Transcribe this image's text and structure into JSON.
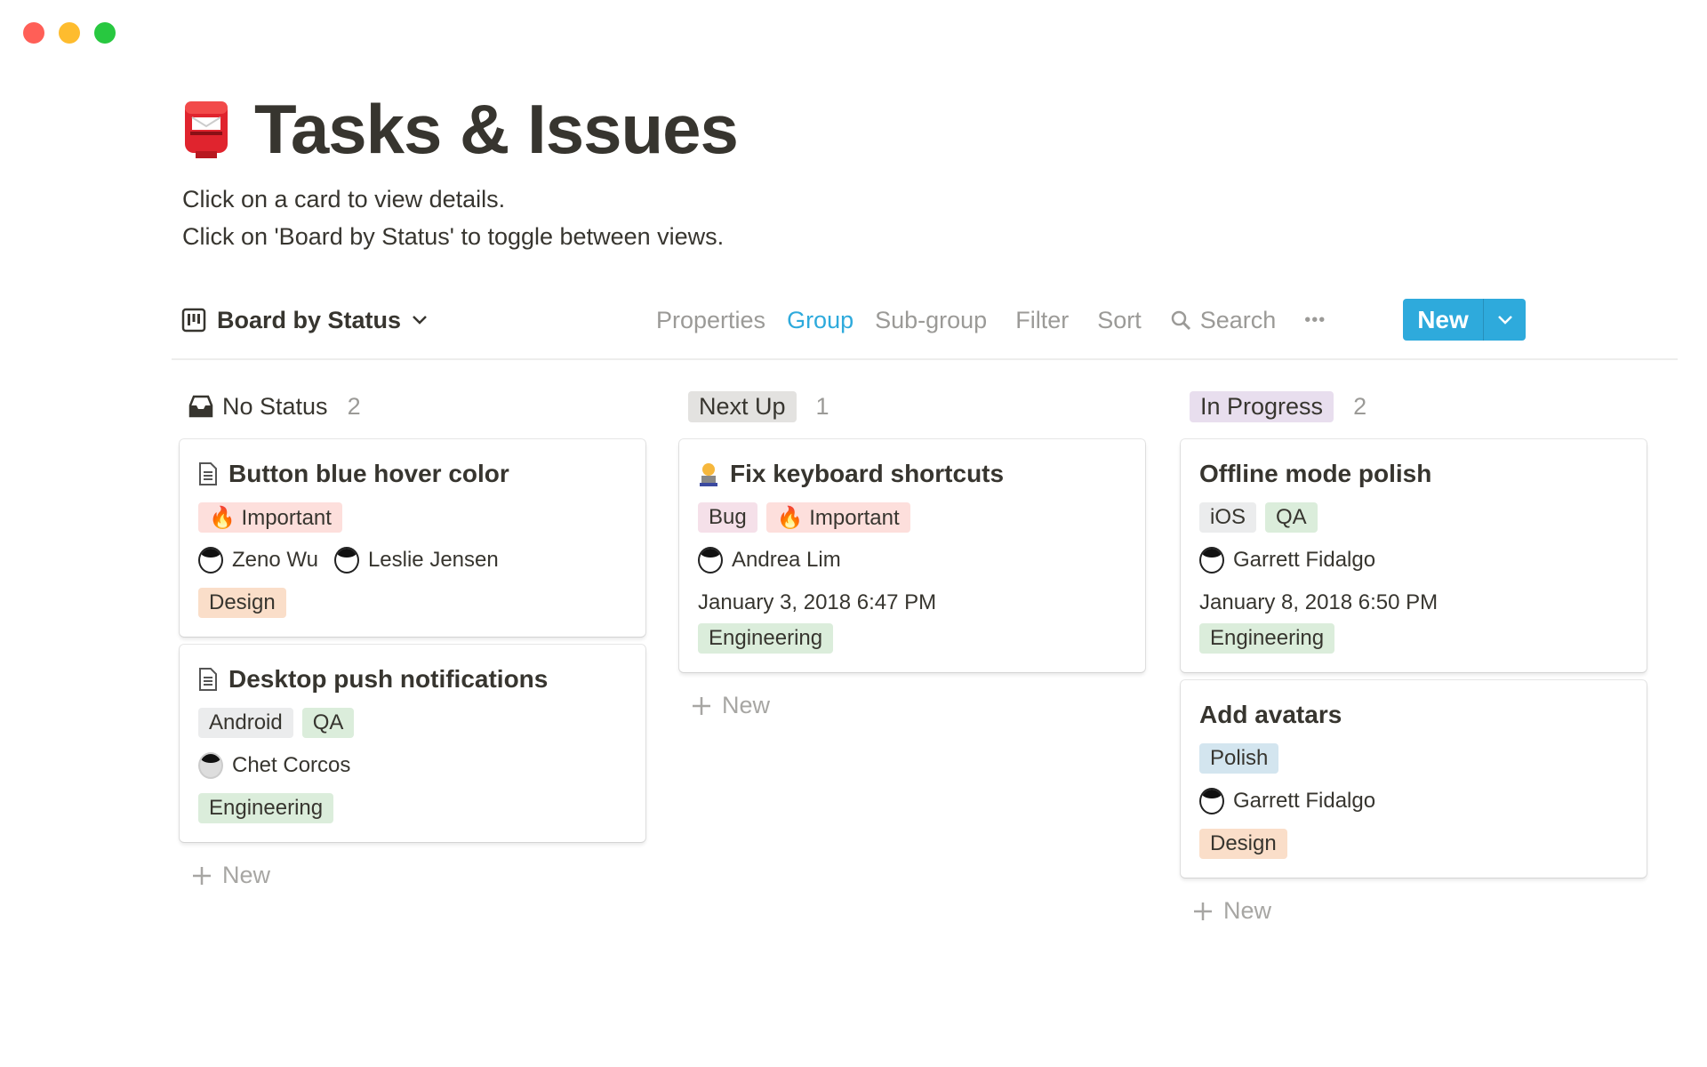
{
  "window": {
    "controls": [
      "close",
      "minimize",
      "maximize"
    ],
    "colors": {
      "close": "#ff5f57",
      "minimize": "#febc2e",
      "maximize": "#28c840"
    }
  },
  "page": {
    "icon": "postbox-emoji",
    "title": "Tasks & Issues",
    "description": [
      "Click on a card to view details.",
      "Click on 'Board by Status' to toggle between views."
    ]
  },
  "toolbar": {
    "view_name": "Board by Status",
    "properties": "Properties",
    "group": "Group",
    "subgroup": "Sub-group",
    "filter": "Filter",
    "sort": "Sort",
    "search": "Search",
    "more": "•••",
    "new": "New",
    "accent": "#2eaadc"
  },
  "columns": [
    {
      "name": "No Status",
      "count": "2",
      "add_label": "New",
      "cards": [
        {
          "title": "Button blue hover color",
          "icon": "page-icon",
          "tags": [
            {
              "label": "🔥 Important",
              "bg": "#fddfdc"
            }
          ],
          "people": [
            "Zeno Wu",
            "Leslie Jensen"
          ],
          "date": "",
          "team": {
            "label": "Design",
            "bg": "#fadec9"
          }
        },
        {
          "title": "Desktop push notifications",
          "icon": "page-icon",
          "tags": [
            {
              "label": "Android",
              "bg": "#ebeced"
            },
            {
              "label": "QA",
              "bg": "#dbeddb"
            }
          ],
          "people": [
            "Chet Corcos"
          ],
          "date": "",
          "team": {
            "label": "Engineering",
            "bg": "#dbeddb"
          }
        }
      ]
    },
    {
      "name": "Next Up",
      "count": "1",
      "pill": "#e3e2e0",
      "add_label": "New",
      "cards": [
        {
          "title": "Fix keyboard shortcuts",
          "icon": "technologist-emoji",
          "tags": [
            {
              "label": "Bug",
              "bg": "#f5e0e9"
            },
            {
              "label": "🔥 Important",
              "bg": "#fddfdc"
            }
          ],
          "people": [
            "Andrea Lim"
          ],
          "date": "January 3, 2018 6:47 PM",
          "team": {
            "label": "Engineering",
            "bg": "#dbeddb"
          }
        }
      ]
    },
    {
      "name": "In Progress",
      "count": "2",
      "pill": "#e8deee",
      "add_label": "New",
      "cards": [
        {
          "title": "Offline mode polish",
          "icon": "",
          "tags": [
            {
              "label": "iOS",
              "bg": "#ebeced"
            },
            {
              "label": "QA",
              "bg": "#dbeddb"
            }
          ],
          "people": [
            "Garrett Fidalgo"
          ],
          "date": "January 8, 2018 6:50 PM",
          "team": {
            "label": "Engineering",
            "bg": "#dbeddb"
          }
        },
        {
          "title": "Add avatars",
          "icon": "",
          "tags": [
            {
              "label": "Polish",
              "bg": "#d3e5ef"
            }
          ],
          "people": [
            "Garrett Fidalgo"
          ],
          "date": "",
          "team": {
            "label": "Design",
            "bg": "#fadec9"
          }
        }
      ]
    }
  ]
}
